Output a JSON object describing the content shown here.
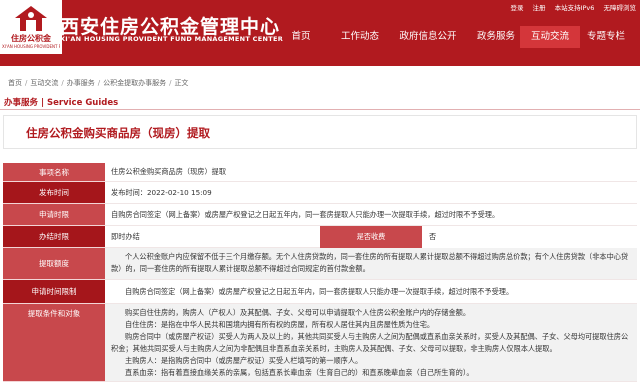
{
  "header": {
    "logo_cn": "住房公积金",
    "logo_en": "XI'AN HOUSING PROVIDENT FUND",
    "title": "西安住房公积金管理中心",
    "subtitle": "XI'AN HOUSING PROVIDENT FUND MANAGEMENT CENTER",
    "toplinks": [
      "登录",
      "注册",
      "本站支持IPv6",
      "无障碍浏览"
    ],
    "nav": [
      "首页",
      "工作动态",
      "政府信息公开",
      "政务服务",
      "互动交流",
      "专题专栏"
    ],
    "active_nav_index": 4
  },
  "breadcrumb": [
    "首页",
    "互动交流",
    "办事服务",
    "公积金提取办事服务",
    "正文"
  ],
  "section_heading": "办事服务 | Service Guides",
  "page_title": "住房公积金购买商品房（现房）提取",
  "rows": {
    "item_name": {
      "label": "事项名称",
      "value": "住房公积金购买商品房（现房）提取"
    },
    "publish_time": {
      "label": "发布时间",
      "value": "发布时间：2022-02-10 15:09"
    },
    "apply_period": {
      "label": "申请时限",
      "value": "自购房合同签定（网上备案）或房屋产权登记之日起五年内，同一套房提取人只能办理一次提取手续，超过时限不予受理。"
    },
    "process_period": {
      "label": "办结时限",
      "value": "即时办结",
      "badge": "是否收费",
      "fee": "否"
    },
    "withdraw_amount": {
      "label": "提取额度",
      "value": "个人公积金账户内应保留不低于三个月缴存额。无个人住房贷款的，同一套住房的所有提取人累计提取总额不得超过购房总价款；有个人住房贷款（非本中心贷款）的，同一套住房的所有提取人累计提取总额不得超过合同规定的首付款金额。"
    },
    "time_limit": {
      "label": "申请时间限制",
      "value": "自购房合同签定（网上备案）或房屋产权登记之日起五年内，同一套房提取人只能办理一次提取手续，超过时限不予受理。"
    },
    "conditions": {
      "label": "提取条件和对象",
      "lines": [
        "购买自住住房的，购房人（产权人）及其配偶、子女、父母可以申请提取个人住房公积金账户内的存储金额。",
        "自住住房：是指在中华人民共和国境内拥有所有权的房屋，所有权人居住其内且房屋性质为住宅。",
        "购房合同中（或房屋产权证）买受人为两人及以上的，其他共同买受人与主购房人之间为配偶或直系血亲关系时，买受人及其配偶、子女、父母均可提取住房公积金；其他共同买受人与主购房人之间为非配偶且非直系血亲关系时，主购房人及其配偶、子女、父母可以提取，非主购房人仅限本人提取。",
        "主购房人：是指购房合同中（或房屋产权证）买受人栏填写的第一顺序人。",
        "直系血亲：指有着直接血缘关系的亲属，包括直系长辈血亲（生育自己的）和直系晚辈血亲（自己所生育的）。"
      ]
    }
  },
  "colors": {
    "brand_red": "#b11a1f",
    "label_light": "#c8484c",
    "label_dark": "#a5161b"
  }
}
